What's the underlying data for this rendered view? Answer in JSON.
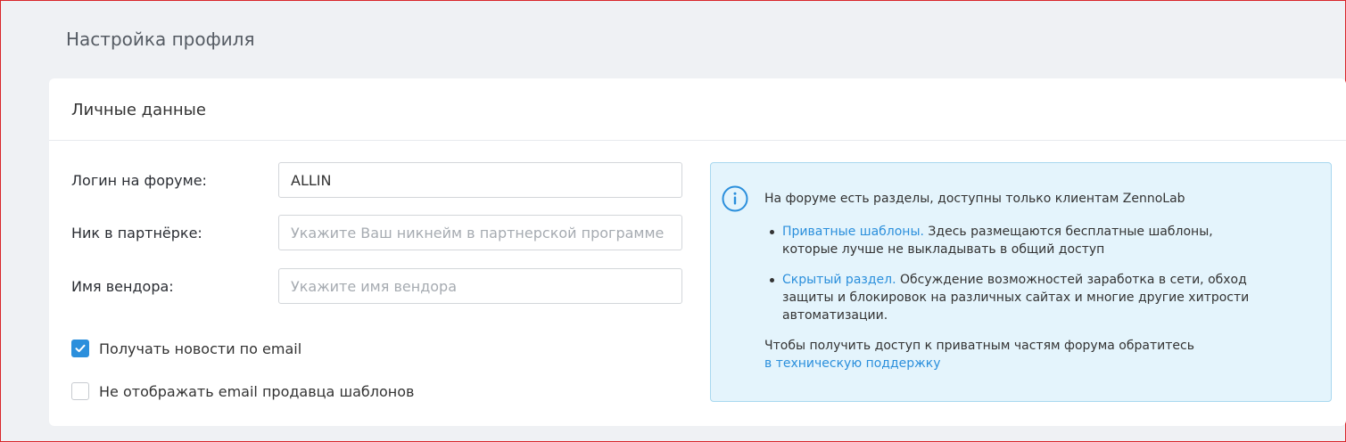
{
  "page": {
    "title": "Настройка профиля"
  },
  "card": {
    "title": "Личные данные"
  },
  "form": {
    "login": {
      "label": "Логин на форуме:",
      "value": "ALLIN"
    },
    "nick": {
      "label": "Ник в партнёрке:",
      "value": "",
      "placeholder": "Укажите Ваш никнейм в партнерской программе"
    },
    "vendor": {
      "label": "Имя вендора:",
      "value": "",
      "placeholder": "Укажите имя вендора"
    }
  },
  "checkboxes": {
    "news": {
      "label": "Получать новости по email",
      "checked": true
    },
    "hide_email": {
      "label": "Не отображать email продавца шаблонов",
      "checked": false
    }
  },
  "info": {
    "intro": "На форуме есть разделы, доступны только клиентам ZennoLab",
    "items": [
      {
        "link": "Приватные шаблоны.",
        "text": " Здесь размещаются бесплатные шаблоны, которые лучше не выкладывать в общий доступ"
      },
      {
        "link": "Скрытый раздел.",
        "text": " Обсуждение возможностей заработка в сети, обход защиты и блокировок на различных сайтах и многие другие хитрости автоматизации."
      }
    ],
    "footer_text": "Чтобы получить доступ к приватным частям форума обратитесь",
    "footer_link": "в техническую поддержку"
  },
  "colors": {
    "accent": "#2b8fdc",
    "info_bg": "#e4f4fc",
    "info_border": "#a8d8ef",
    "page_bg": "#eff1f4"
  },
  "icons": {
    "info": "info-circle-icon",
    "check": "checkmark-icon"
  }
}
